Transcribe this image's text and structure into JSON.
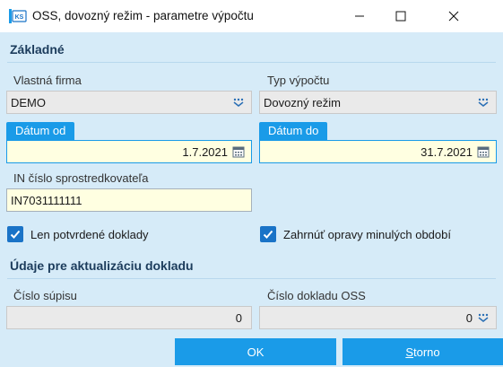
{
  "window": {
    "title": "OSS, dovozný režim - parametre výpočtu",
    "icons": {
      "app": "app-icon",
      "minimize": "minimize-icon",
      "maximize": "maximize-icon",
      "close": "close-icon"
    }
  },
  "section_basic": {
    "title": "Základné",
    "company": {
      "label": "Vlastná firma",
      "value": "DEMO",
      "icon": "dropdown-icon"
    },
    "calc_type": {
      "label": "Typ výpočtu",
      "value": "Dovozný režim",
      "icon": "dropdown-icon"
    },
    "date_from": {
      "label": "Dátum od",
      "value": "1.7.2021",
      "icon": "calendar-icon"
    },
    "date_to": {
      "label": "Dátum do",
      "value": "31.7.2021",
      "icon": "calendar-icon"
    },
    "intermediary_in": {
      "label": "IN číslo sprostredkovateľa",
      "value": "IN7031111111"
    },
    "only_confirmed": {
      "label": "Len potvrdené doklady",
      "checked": true
    },
    "include_corrections": {
      "label": "Zahrnúť opravy minulých období",
      "checked": true
    }
  },
  "section_update": {
    "title": "Údaje pre aktualizáciu dokladu",
    "list_number": {
      "label": "Číslo súpisu",
      "value": "0"
    },
    "oss_doc_number": {
      "label": "Číslo dokladu OSS",
      "value": "0",
      "icon": "dropdown-icon"
    }
  },
  "buttons": {
    "ok": "OK",
    "cancel_first": "S",
    "cancel_rest": "torno"
  },
  "colors": {
    "accent": "#1a9be8",
    "panel": "#d6ebf8",
    "input_required": "#ffffe1",
    "checkbox": "#1a73c7"
  }
}
